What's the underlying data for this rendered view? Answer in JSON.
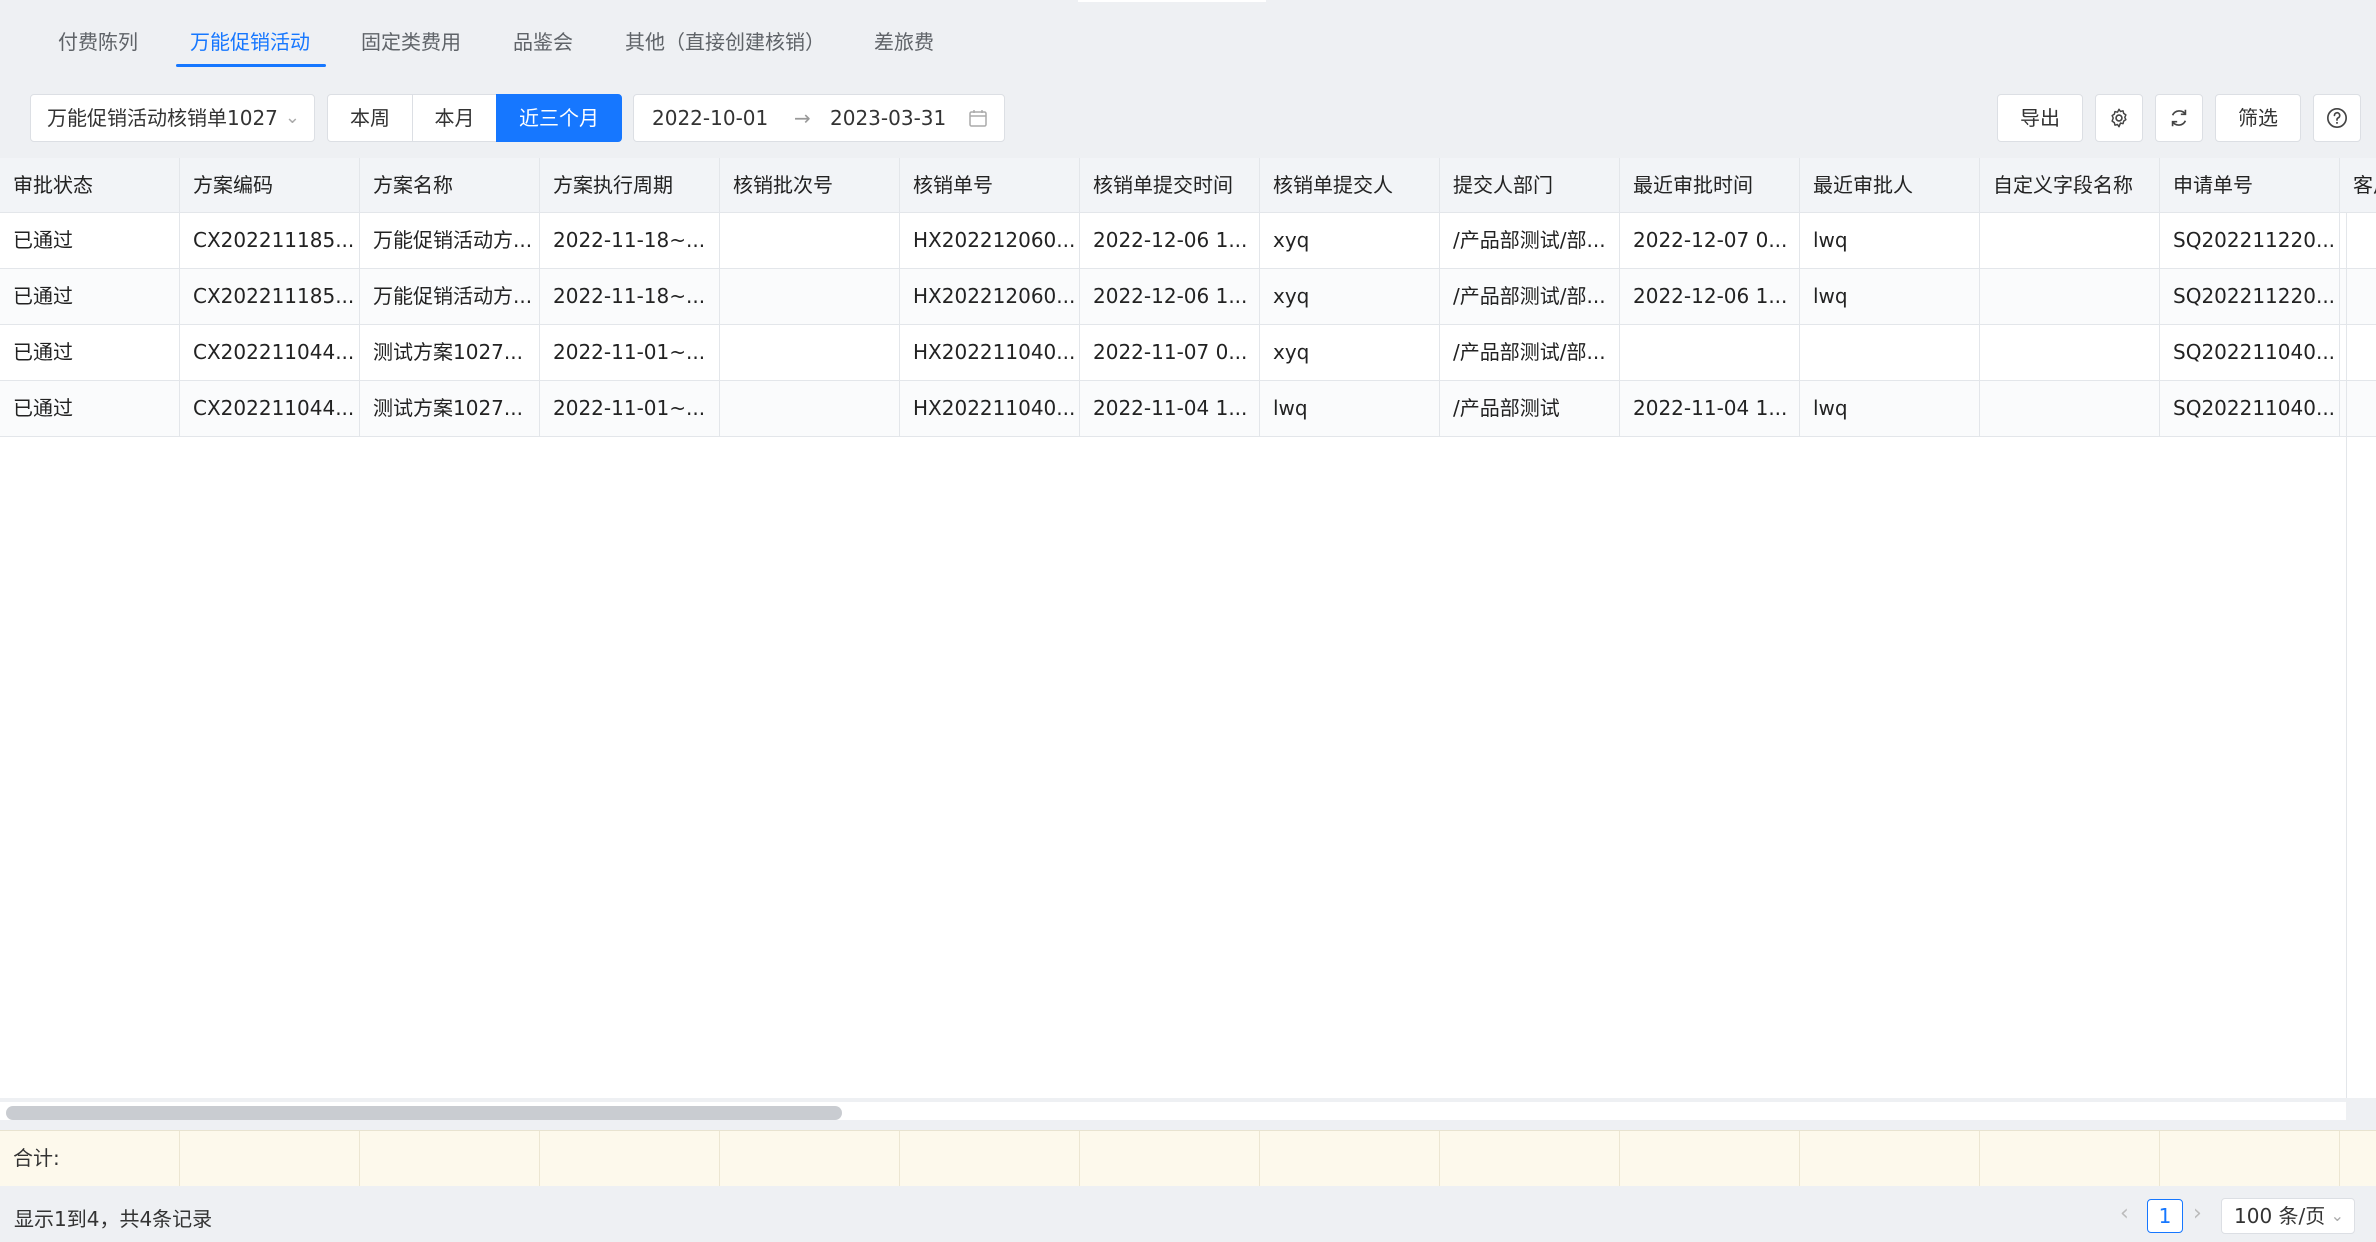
{
  "tabs": [
    {
      "label": "付费陈列"
    },
    {
      "label": "万能促销活动"
    },
    {
      "label": "固定类费用"
    },
    {
      "label": "品鉴会"
    },
    {
      "label": "其他（直接创建核销）"
    },
    {
      "label": "差旅费"
    }
  ],
  "active_tab_index": 1,
  "toolbar": {
    "form_select": "万能促销活动核销单1027",
    "range_buttons": [
      "本周",
      "本月",
      "近三个月"
    ],
    "active_range_index": 2,
    "date_start": "2022-10-01",
    "date_separator": "→",
    "date_end": "2023-03-31",
    "export_label": "导出",
    "filter_label": "筛选"
  },
  "table": {
    "columns": [
      "审批状态",
      "方案编码",
      "方案名称",
      "方案执行周期",
      "核销批次号",
      "核销单号",
      "核销单提交时间",
      "核销单提交人",
      "提交人部门",
      "最近审批时间",
      "最近审批人",
      "自定义字段名称",
      "申请单号",
      "客户"
    ],
    "rows": [
      [
        "已通过",
        "CX202211185...",
        "万能促销活动方...",
        "2022-11-18~...",
        "",
        "HX202212060...",
        "2022-12-06 1...",
        "xyq",
        "/产品部测试/部...",
        "2022-12-07 0...",
        "lwq",
        "",
        "SQ202211220...",
        ""
      ],
      [
        "已通过",
        "CX202211185...",
        "万能促销活动方...",
        "2022-11-18~...",
        "",
        "HX202212060...",
        "2022-12-06 1...",
        "xyq",
        "/产品部测试/部...",
        "2022-12-06 1...",
        "lwq",
        "",
        "SQ202211220...",
        ""
      ],
      [
        "已通过",
        "CX202211044...",
        "测试方案1027...",
        "2022-11-01~...",
        "",
        "HX202211040...",
        "2022-11-07 0...",
        "xyq",
        "/产品部测试/部...",
        "",
        "",
        "",
        "SQ202211040...",
        ""
      ],
      [
        "已通过",
        "CX202211044...",
        "测试方案1027...",
        "2022-11-01~...",
        "",
        "HX202211040...",
        "2022-11-04 1...",
        "lwq",
        "/产品部测试",
        "2022-11-04 1...",
        "lwq",
        "",
        "SQ202211040...",
        ""
      ]
    ],
    "summary_label": "合计:"
  },
  "footer": {
    "record_info": "显示1到4，共4条记录",
    "current_page": "1",
    "page_size": "100 条/页"
  },
  "colors": {
    "accent": "#1677ff",
    "summary_bg": "#fdf9ec",
    "header_bg": "#f2f4f7"
  }
}
